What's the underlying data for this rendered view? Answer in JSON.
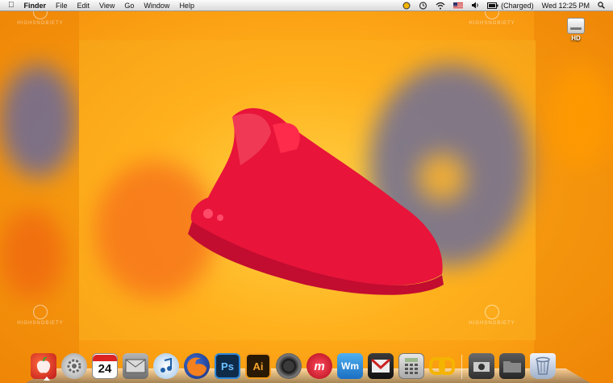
{
  "menubar": {
    "app_name": "Finder",
    "menus": [
      "File",
      "Edit",
      "View",
      "Go",
      "Window",
      "Help"
    ],
    "battery_status": "(Charged)",
    "clock": "Wed 12:25 PM"
  },
  "desktop": {
    "drive_label": "HD",
    "watermark_text": "HIGHSNOBIETY"
  },
  "dock": {
    "items": [
      {
        "name": "Finder"
      },
      {
        "name": "System Preferences"
      },
      {
        "name": "iCal",
        "badge": "24"
      },
      {
        "name": "Mail"
      },
      {
        "name": "iTunes"
      },
      {
        "name": "Firefox"
      },
      {
        "name": "Photoshop",
        "glyph": "Ps"
      },
      {
        "name": "Illustrator",
        "glyph": "Ai"
      },
      {
        "name": "Camera"
      },
      {
        "name": "m"
      },
      {
        "name": "Wm"
      },
      {
        "name": "Gmail"
      },
      {
        "name": "Calculator"
      },
      {
        "name": "Links"
      },
      {
        "name": "Camera Folder"
      },
      {
        "name": "Folder"
      },
      {
        "name": "Trash"
      }
    ]
  }
}
